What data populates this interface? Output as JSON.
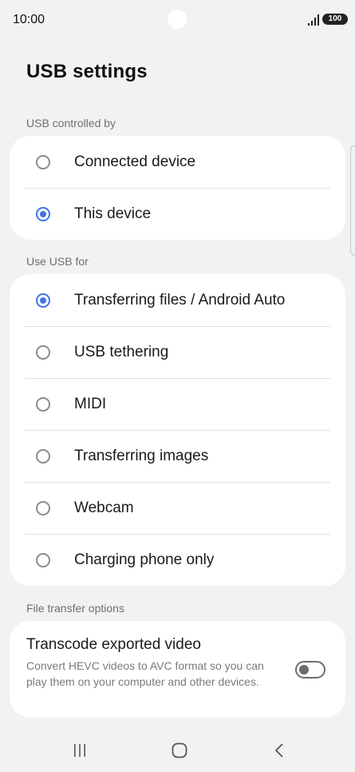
{
  "status_bar": {
    "time": "10:00",
    "battery": "100"
  },
  "page": {
    "title": "USB settings"
  },
  "usb_controlled_by": {
    "label": "USB controlled by",
    "options": [
      {
        "label": "Connected device",
        "selected": false
      },
      {
        "label": "This device",
        "selected": true
      }
    ]
  },
  "use_usb_for": {
    "label": "Use USB for",
    "options": [
      {
        "label": "Transferring files / Android Auto",
        "selected": true
      },
      {
        "label": "USB tethering",
        "selected": false
      },
      {
        "label": "MIDI",
        "selected": false
      },
      {
        "label": "Transferring images",
        "selected": false
      },
      {
        "label": "Webcam",
        "selected": false
      },
      {
        "label": "Charging phone only",
        "selected": false
      }
    ]
  },
  "file_transfer_options": {
    "label": "File transfer options",
    "transcode": {
      "title": "Transcode exported video",
      "description": "Convert HEVC videos to AVC format so you can play them on your computer and other devices.",
      "enabled": false
    }
  },
  "colors": {
    "accent": "#3e73e8",
    "background": "#f2f2f4",
    "card": "#ffffff"
  },
  "icons": {
    "nav_recents": "recents-icon",
    "nav_home": "home-icon",
    "nav_back": "back-icon"
  }
}
